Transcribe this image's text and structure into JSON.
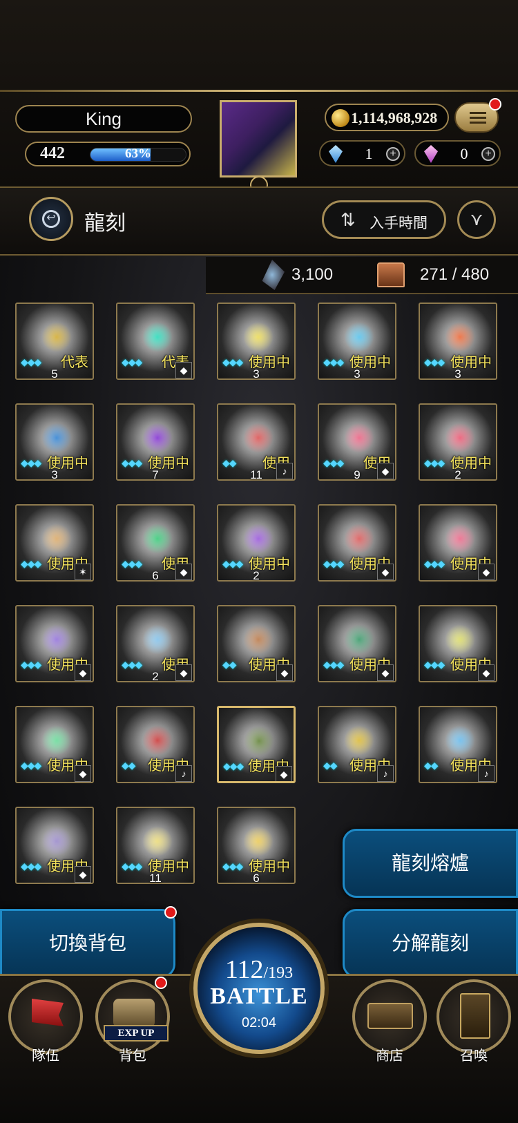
{
  "player": {
    "name": "King",
    "level": "442",
    "exp_percent": "63%",
    "exp_fraction": 0.63,
    "gold": "1,114,968,928",
    "gem_blue": "1",
    "gem_pink": "0"
  },
  "header": {
    "title": "龍刻",
    "sort_label": "入手時間",
    "sort_icon": "sort-icon",
    "filter_icon": "filter-icon"
  },
  "stats": {
    "relic_points": "3,100",
    "capacity": "271 / 480"
  },
  "items": [
    {
      "stars": 3,
      "status": "代表",
      "tag": "",
      "count": "5",
      "art": "#d8b23a"
    },
    {
      "stars": 3,
      "status": "代表",
      "tag": "◆",
      "count": "",
      "art": "#33e0c0"
    },
    {
      "stars": 3,
      "status": "使用中",
      "tag": "",
      "count": "3",
      "art": "#f0e060"
    },
    {
      "stars": 3,
      "status": "使用中",
      "tag": "",
      "count": "3",
      "art": "#60c8f0"
    },
    {
      "stars": 3,
      "status": "使用中",
      "tag": "",
      "count": "3",
      "art": "#f07040"
    },
    {
      "stars": 3,
      "status": "使用中",
      "tag": "",
      "count": "3",
      "art": "#3a8ad8"
    },
    {
      "stars": 3,
      "status": "使用中",
      "tag": "",
      "count": "7",
      "art": "#8a3ad8"
    },
    {
      "stars": 2,
      "status": "使用",
      "tag": "♪",
      "count": "11",
      "art": "#e05a5a"
    },
    {
      "stars": 3,
      "status": "使用",
      "tag": "◆",
      "count": "9",
      "art": "#f06a8a"
    },
    {
      "stars": 3,
      "status": "使用中",
      "tag": "",
      "count": "2",
      "art": "#f0607a"
    },
    {
      "stars": 3,
      "status": "使用中",
      "tag": "✶",
      "count": "",
      "art": "#e0b070"
    },
    {
      "stars": 3,
      "status": "使用",
      "tag": "◆",
      "count": "6",
      "art": "#40d080"
    },
    {
      "stars": 3,
      "status": "使用中",
      "tag": "",
      "count": "2",
      "art": "#a060e0"
    },
    {
      "stars": 3,
      "status": "使用中",
      "tag": "◆",
      "count": "",
      "art": "#e06060"
    },
    {
      "stars": 3,
      "status": "使用中",
      "tag": "◆",
      "count": "",
      "art": "#f07090"
    },
    {
      "stars": 3,
      "status": "使用中",
      "tag": "◆",
      "count": "",
      "art": "#9a7ae0"
    },
    {
      "stars": 3,
      "status": "使用",
      "tag": "◆",
      "count": "2",
      "art": "#8ac8f0"
    },
    {
      "stars": 2,
      "status": "使用中",
      "tag": "◆",
      "count": "",
      "art": "#c08050"
    },
    {
      "stars": 3,
      "status": "使用中",
      "tag": "◆",
      "count": "",
      "art": "#40a070"
    },
    {
      "stars": 3,
      "status": "使用中",
      "tag": "◆",
      "count": "",
      "art": "#e0e070"
    },
    {
      "stars": 3,
      "status": "使用中",
      "tag": "◆",
      "count": "",
      "art": "#70e0a0"
    },
    {
      "stars": 2,
      "status": "使用中",
      "tag": "♪",
      "count": "",
      "art": "#d04040"
    },
    {
      "stars": 3,
      "status": "使用中",
      "tag": "◆",
      "count": "",
      "art": "#6a8a40",
      "gold": true
    },
    {
      "stars": 2,
      "status": "使用中",
      "tag": "♪",
      "count": "",
      "art": "#e0c040"
    },
    {
      "stars": 2,
      "status": "使用中",
      "tag": "♪",
      "count": "",
      "art": "#70c0f0"
    },
    {
      "stars": 3,
      "status": "使用中",
      "tag": "◆",
      "count": "",
      "art": "#a090d0"
    },
    {
      "stars": 3,
      "status": "使用中",
      "tag": "",
      "count": "11",
      "art": "#f0e080"
    },
    {
      "stars": 3,
      "status": "使用中",
      "tag": "",
      "count": "6",
      "art": "#f0d060"
    }
  ],
  "buttons": {
    "forge": "龍刻熔爐",
    "dismantle": "分解龍刻",
    "switch_bag": "切換背包"
  },
  "battle": {
    "current": "112",
    "max": "/193",
    "label": "BATTLE",
    "timer": "02:04"
  },
  "nav": {
    "team": "隊伍",
    "bag": "背包",
    "exp_up": "EXP UP",
    "shop": "商店",
    "summon": "召喚"
  }
}
